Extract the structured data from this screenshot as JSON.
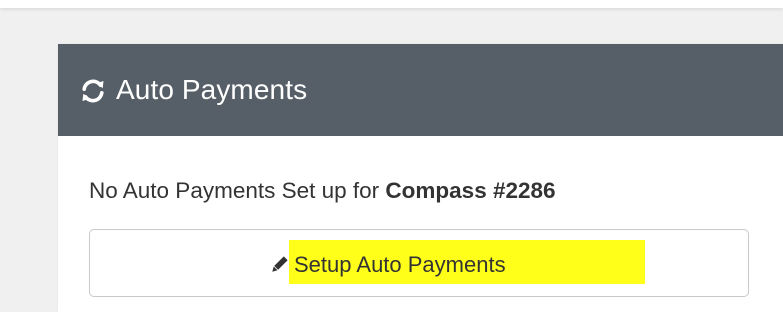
{
  "panel": {
    "title": "Auto Payments",
    "title_icon": "refresh-icon",
    "header_color": "#565f67"
  },
  "status": {
    "prefix": "No Auto Payments Set up for ",
    "account": "Compass #2286"
  },
  "setup_button": {
    "label": "Setup Auto Payments",
    "icon": "pencil-icon",
    "highlight_color": "#ffff1a"
  }
}
